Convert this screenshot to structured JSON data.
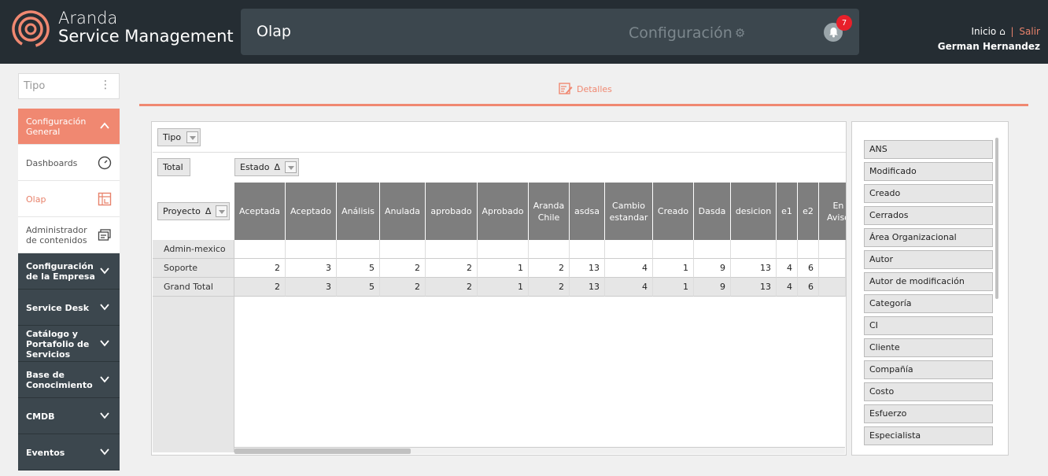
{
  "header": {
    "brand_line1": "Aranda",
    "brand_line2": "Service Management",
    "module": "Olap",
    "config_label": "Configuración",
    "notifications": "7",
    "inicio": "Inicio",
    "separator": "|",
    "salir": "Salir",
    "user": "German Hernandez",
    "brand_color": "#f08871"
  },
  "sidebar": {
    "search_placeholder": "Tipo",
    "items": [
      {
        "label": "Configuración General"
      },
      {
        "label": "Dashboards"
      },
      {
        "label": "Olap"
      },
      {
        "label": "Administrador de contenidos"
      },
      {
        "label": "Configuración de la Empresa"
      },
      {
        "label": "Service Desk"
      },
      {
        "label": "Catálogo y Portafolio de Servicios"
      },
      {
        "label": "Base de Conocimiento"
      },
      {
        "label": "CMDB"
      },
      {
        "label": "Eventos"
      }
    ]
  },
  "content": {
    "tab_label": "Detalles"
  },
  "pivot": {
    "filter_field": "Tipo",
    "total_label": "Total",
    "column_field": "Estado",
    "row_field": "Proyecto",
    "sort_glyph": "Δ",
    "columns": [
      "Aceptada",
      "Aceptado",
      "Análisis",
      "Anulada",
      "aprobado",
      "Aprobado",
      "Aranda Chile",
      "asdsa",
      "Cambio estandar",
      "Creado",
      "Dasda",
      "desicion",
      "e1",
      "e2",
      "En Aviso"
    ],
    "rows": [
      {
        "label": "Admin-mexico",
        "values": [
          "",
          "",
          "",
          "",
          "",
          "",
          "",
          "",
          "",
          "",
          "",
          "",
          "",
          "",
          ""
        ]
      },
      {
        "label": "Soporte",
        "values": [
          "2",
          "3",
          "5",
          "2",
          "2",
          "1",
          "2",
          "13",
          "4",
          "1",
          "9",
          "13",
          "4",
          "6",
          ""
        ]
      },
      {
        "label": "Grand Total",
        "values": [
          "2",
          "3",
          "5",
          "2",
          "2",
          "1",
          "2",
          "13",
          "4",
          "1",
          "9",
          "13",
          "4",
          "6",
          ""
        ]
      }
    ]
  },
  "fields": [
    "ANS",
    "Modificado",
    "Creado",
    "Cerrados",
    "Área Organizacional",
    "Autor",
    "Autor de modificación",
    "Categoría",
    "CI",
    "Cliente",
    "Compañía",
    "Costo",
    "Esfuerzo",
    "Especialista"
  ]
}
